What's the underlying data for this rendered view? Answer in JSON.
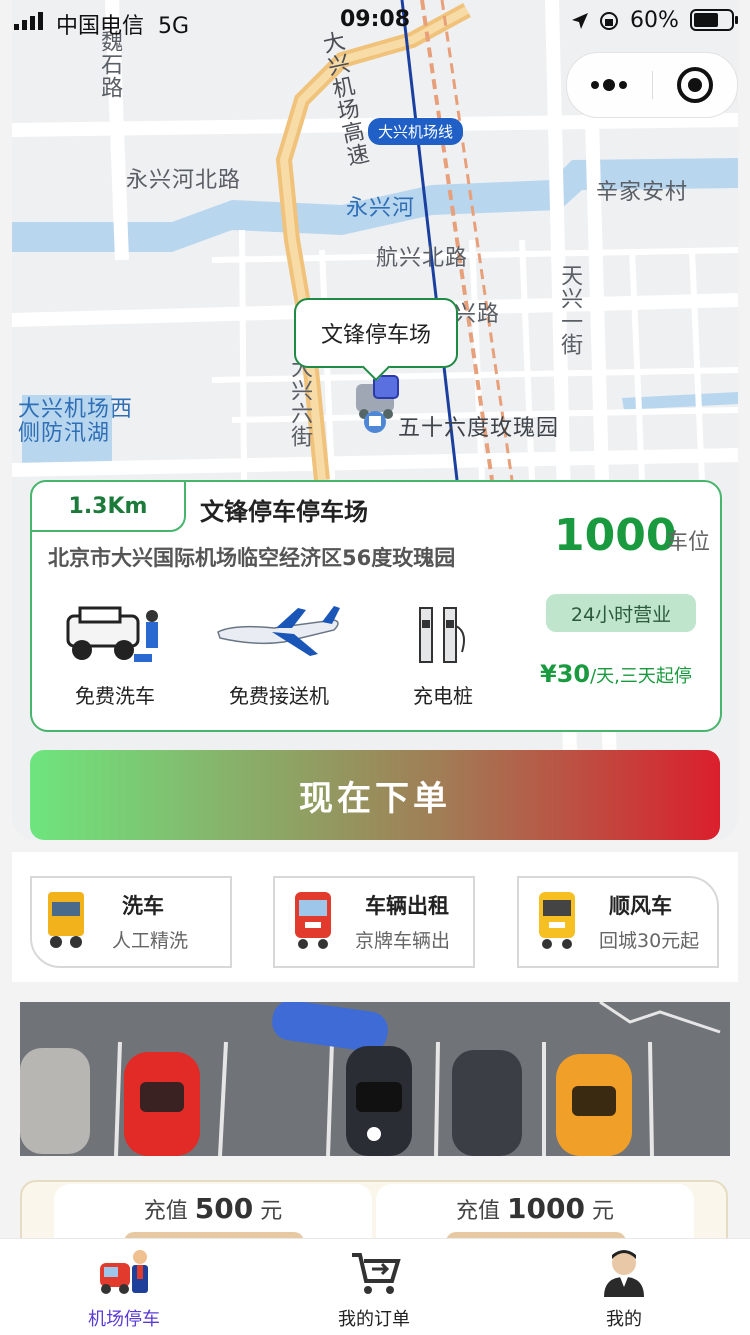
{
  "status_bar": {
    "carrier": "中国电信",
    "network": "5G",
    "time": "09:08",
    "battery": "60%"
  },
  "map": {
    "labels": {
      "weishi_road": "魏石路",
      "yongxing_north_road": "永兴河北路",
      "yongxing_river": "永兴河",
      "xinjia_village": "辛家安村",
      "hangxing_north_road": "航兴北路",
      "xing_road_partial": "兴路",
      "daxing_first_street": "天兴一街",
      "daxing_sixth_street": "大兴六街",
      "airport_expressway": "大兴机场高速",
      "airport_flood_lake": "大兴机场西侧防汛湖",
      "rose_garden": "五十六度玫瑰园"
    },
    "metro_badge": "大兴机场线",
    "callout": "文锋停车场"
  },
  "card": {
    "distance": "1.3Km",
    "title": "文锋停车停车场",
    "address": "北京市大兴国际机场临空经济区56度玫瑰园",
    "spaces": "1000",
    "spaces_unit": "车位",
    "hours": "24小时营业",
    "price": "¥30",
    "price_unit": "/天,三天起停",
    "features": [
      {
        "label": "免费洗车",
        "icon": "car-wash-icon"
      },
      {
        "label": "免费接送机",
        "icon": "airplane-icon"
      },
      {
        "label": "充电桩",
        "icon": "charging-pile-icon"
      }
    ]
  },
  "order_button": "现在下单",
  "services": [
    {
      "title": "洗车",
      "subtitle": "人工精洗"
    },
    {
      "title": "车辆出租",
      "subtitle": "京牌车辆出"
    },
    {
      "title": "顺风车",
      "subtitle": "回城30元起"
    }
  ],
  "recharge": [
    {
      "prefix": "充值",
      "amount": "500",
      "suffix": "元"
    },
    {
      "prefix": "充值",
      "amount": "1000",
      "suffix": "元"
    }
  ],
  "tabs": [
    {
      "label": "机场停车",
      "active": true
    },
    {
      "label": "我的订单",
      "active": false
    },
    {
      "label": "我的",
      "active": false
    }
  ],
  "colors": {
    "accent_green": "#1a9a3e",
    "tab_active": "#5b3bd6",
    "button_gradient_start": "#6ee57e",
    "button_gradient_end": "#db1f2c"
  }
}
